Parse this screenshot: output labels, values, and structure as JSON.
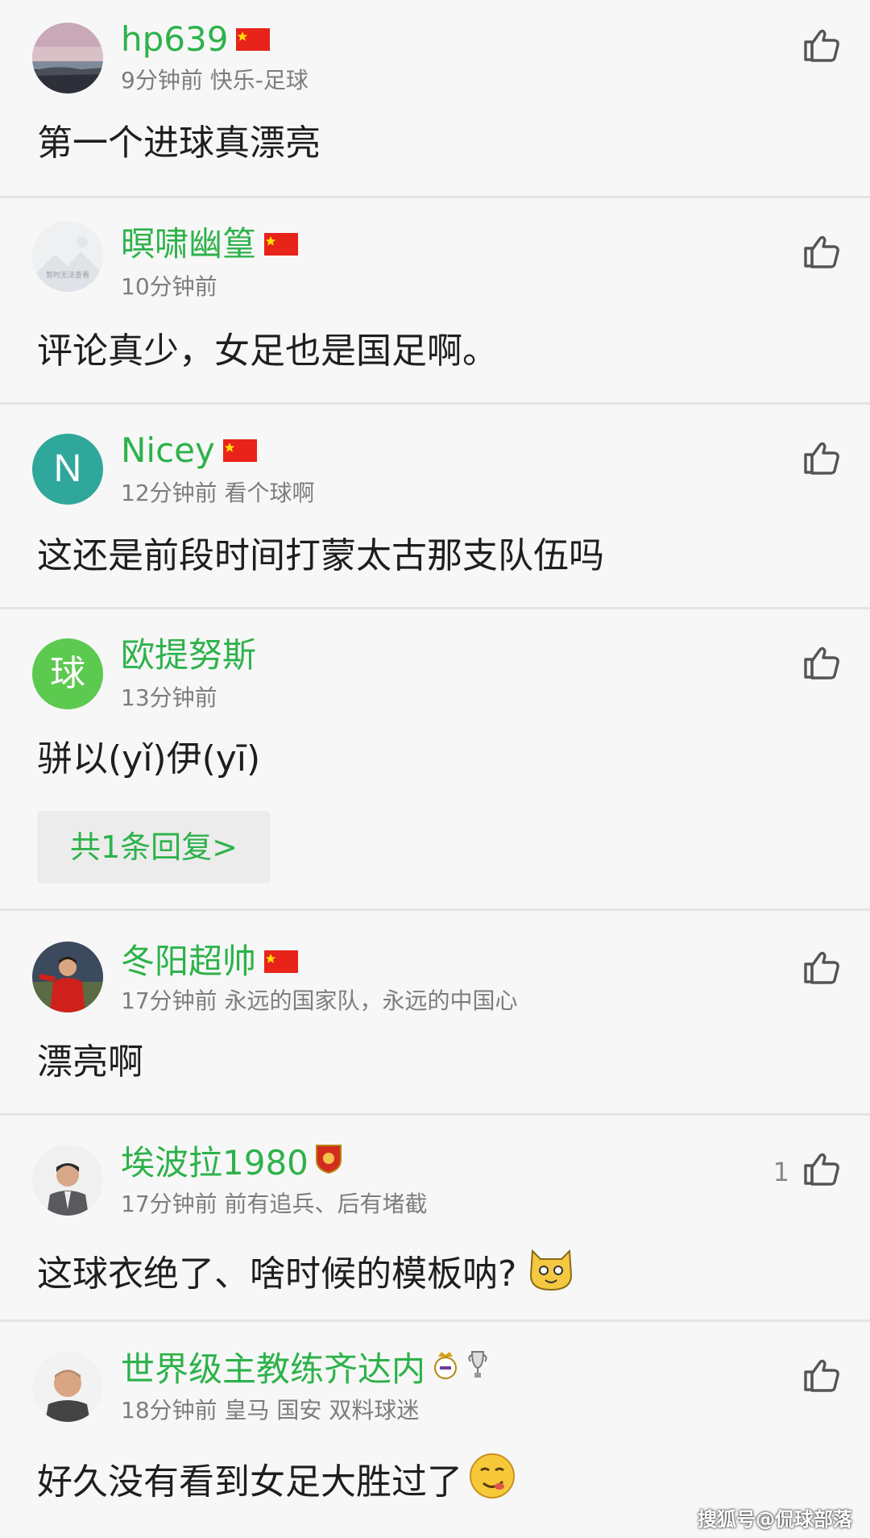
{
  "comments": [
    {
      "user": "hp639",
      "meta": "9分钟前 快乐-足球",
      "text": "第一个进球真漂亮",
      "likes": ""
    },
    {
      "user": "暝啸幽篁",
      "meta": "10分钟前",
      "text": "评论真少，女足也是国足啊。",
      "likes": "",
      "avatar_text": "暂时无法查看"
    },
    {
      "user": "Nicey",
      "meta": "12分钟前 看个球啊",
      "text": "这还是前段时间打蒙太古那支队伍吗",
      "likes": "",
      "avatar_letter": "N"
    },
    {
      "user": "欧提努斯",
      "meta": "13分钟前",
      "text": "骈以(yǐ)伊(yī)",
      "likes": "",
      "avatar_letter": "球",
      "reply": "共1条回复>"
    },
    {
      "user": "冬阳超帅",
      "meta": "17分钟前 永远的国家队，永远的中国心",
      "text": "漂亮啊",
      "likes": ""
    },
    {
      "user": "埃波拉1980",
      "meta": "17分钟前 前有追兵、后有堵截",
      "text": "这球衣绝了、啥时候的模板呐?",
      "likes": "1"
    },
    {
      "user": "世界级主教练齐达内",
      "meta": "18分钟前 皇马 国安 双料球迷",
      "text": "好久没有看到女足大胜过了",
      "likes": ""
    }
  ],
  "watermark": "搜狐号@侃球部落",
  "colors": {
    "accent": "#2db24a",
    "text": "#1e1e1e",
    "meta": "#7d7d7d",
    "background": "#f7f7f7"
  },
  "icons": {
    "like": "thumbs-up-icon",
    "flag": "china-flag-icon"
  }
}
